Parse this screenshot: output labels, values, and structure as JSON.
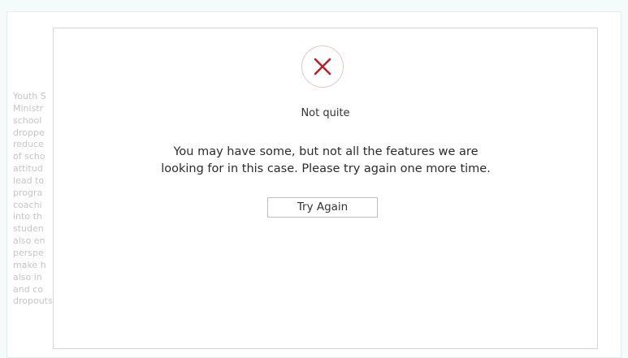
{
  "background": {
    "lines": [
      "Youth S",
      "Ministr",
      "school",
      "droppe",
      "reduce",
      "of scho",
      "attitud",
      "lead to",
      "progra",
      "coachi",
      "into th",
      "studen",
      "also en",
      "perspe",
      "make h",
      "also in",
      "and co",
      "dropouts."
    ]
  },
  "modal": {
    "icon": "close-x-icon",
    "icon_color": "#b0232a",
    "title": "Not quite",
    "message_line1": "You may have some, but not all the features we are",
    "message_line2": "looking for in this case. Please try again one more time.",
    "button_label": "Try Again"
  },
  "colors": {
    "page_background": "#f3fbfb",
    "modal_border": "#d6d6d6",
    "faded_text": "#c5c5c5"
  }
}
